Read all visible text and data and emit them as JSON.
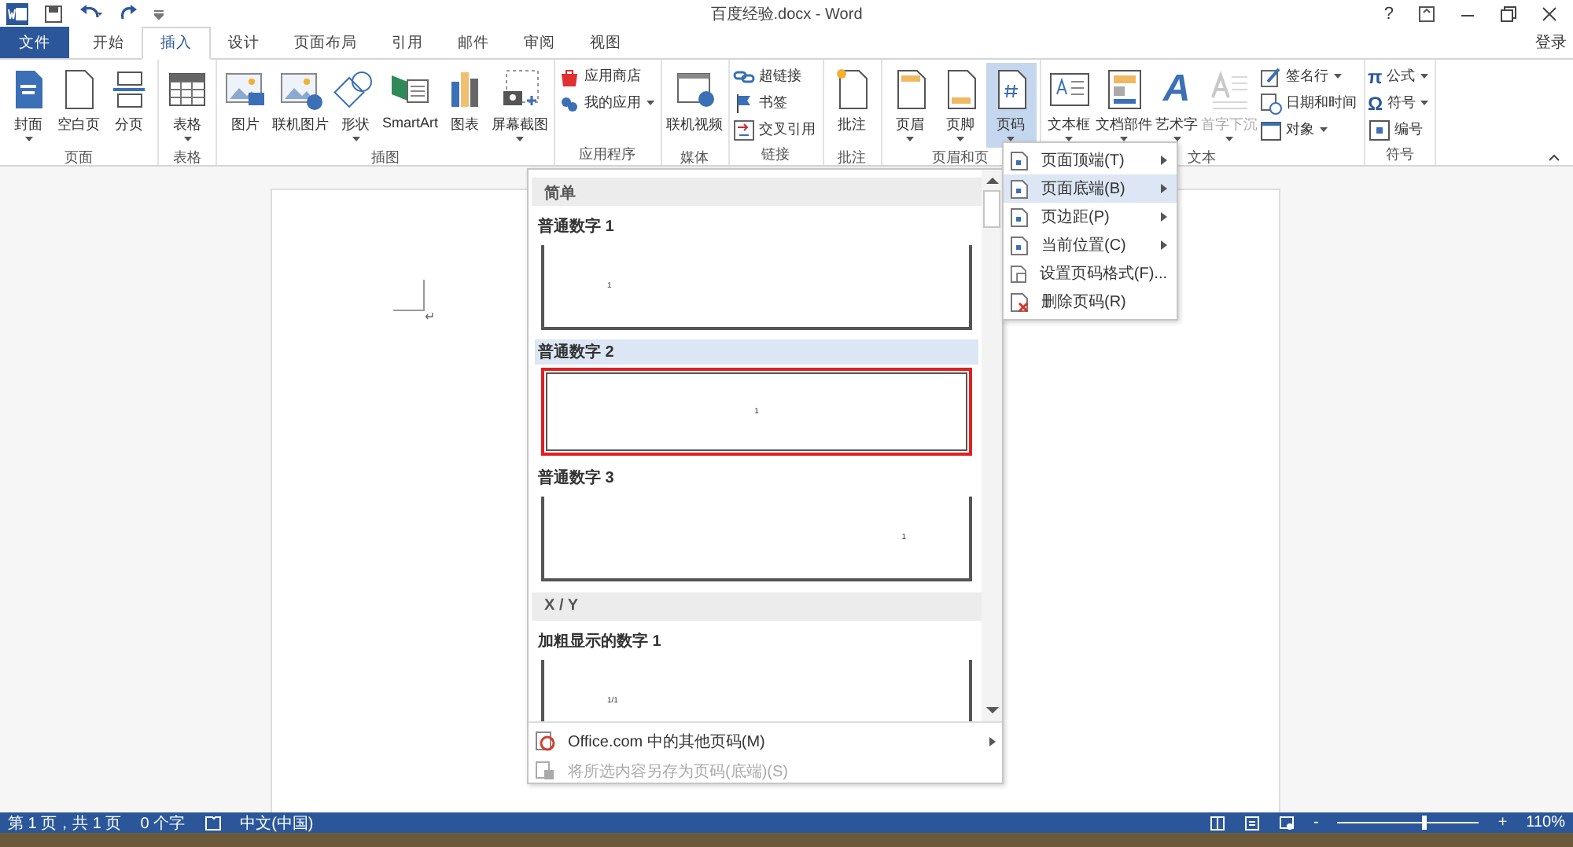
{
  "window": {
    "title": "百度经验.docx - Word",
    "help": "?",
    "login": "登录"
  },
  "tabs": [
    {
      "label": "文件",
      "kind": "file",
      "selected": false
    },
    {
      "label": "开始",
      "kind": "normal",
      "selected": false
    },
    {
      "label": "插入",
      "kind": "normal",
      "selected": true
    },
    {
      "label": "设计",
      "kind": "normal",
      "selected": false
    },
    {
      "label": "页面布局",
      "kind": "normal",
      "selected": false
    },
    {
      "label": "引用",
      "kind": "normal",
      "selected": false
    },
    {
      "label": "邮件",
      "kind": "normal",
      "selected": false
    },
    {
      "label": "审阅",
      "kind": "normal",
      "selected": false
    },
    {
      "label": "视图",
      "kind": "normal",
      "selected": false
    }
  ],
  "ribbon": {
    "groups": [
      {
        "label": "页面",
        "items": [
          {
            "label": "封面",
            "kind": "large",
            "dropdown": true,
            "pressed": false,
            "disabled": false
          },
          {
            "label": "空白页",
            "kind": "large",
            "dropdown": false,
            "pressed": false,
            "disabled": false
          },
          {
            "label": "分页",
            "kind": "large",
            "dropdown": false,
            "pressed": false,
            "disabled": false
          }
        ]
      },
      {
        "label": "表格",
        "items": [
          {
            "label": "表格",
            "kind": "large",
            "dropdown": true,
            "pressed": false,
            "disabled": false
          }
        ]
      },
      {
        "label": "插图",
        "items": [
          {
            "label": "图片",
            "kind": "large",
            "dropdown": false,
            "pressed": false,
            "disabled": false
          },
          {
            "label": "联机图片",
            "kind": "large",
            "dropdown": false,
            "pressed": false,
            "disabled": false
          },
          {
            "label": "形状",
            "kind": "large",
            "dropdown": true,
            "pressed": false,
            "disabled": false
          },
          {
            "label": "SmartArt",
            "kind": "large",
            "dropdown": false,
            "pressed": false,
            "disabled": false
          },
          {
            "label": "图表",
            "kind": "large",
            "dropdown": false,
            "pressed": false,
            "disabled": false
          },
          {
            "label": "屏幕截图",
            "kind": "large",
            "dropdown": true,
            "pressed": false,
            "disabled": false
          }
        ]
      },
      {
        "label": "应用程序",
        "items": [
          {
            "label": "应用商店",
            "kind": "small",
            "dropdown": false,
            "pressed": false,
            "disabled": false
          },
          {
            "label": "我的应用",
            "kind": "small",
            "dropdown": true,
            "pressed": false,
            "disabled": false
          }
        ]
      },
      {
        "label": "媒体",
        "items": [
          {
            "label": "联机视频",
            "kind": "large",
            "dropdown": false,
            "pressed": false,
            "disabled": false
          }
        ]
      },
      {
        "label": "链接",
        "items": [
          {
            "label": "超链接",
            "kind": "small",
            "dropdown": false,
            "pressed": false,
            "disabled": false
          },
          {
            "label": "书签",
            "kind": "small",
            "dropdown": false,
            "pressed": false,
            "disabled": false
          },
          {
            "label": "交叉引用",
            "kind": "small",
            "dropdown": false,
            "pressed": false,
            "disabled": false
          }
        ]
      },
      {
        "label": "批注",
        "items": [
          {
            "label": "批注",
            "kind": "large",
            "dropdown": false,
            "pressed": false,
            "disabled": false
          }
        ]
      },
      {
        "label": "页眉和页",
        "items": [
          {
            "label": "页眉",
            "kind": "large",
            "dropdown": true,
            "pressed": false,
            "disabled": false
          },
          {
            "label": "页脚",
            "kind": "large",
            "dropdown": true,
            "pressed": false,
            "disabled": false
          },
          {
            "label": "页码",
            "kind": "large",
            "dropdown": true,
            "pressed": true,
            "disabled": false
          }
        ]
      },
      {
        "label": "文本",
        "items": [
          {
            "label": "文本框",
            "kind": "large",
            "dropdown": true,
            "pressed": false,
            "disabled": false
          },
          {
            "label": "文档部件",
            "kind": "large",
            "dropdown": true,
            "pressed": false,
            "disabled": false
          },
          {
            "label": "艺术字",
            "kind": "large",
            "dropdown": true,
            "pressed": false,
            "disabled": false,
            "icon_char": "A"
          },
          {
            "label": "首字下沉",
            "kind": "large",
            "dropdown": true,
            "pressed": false,
            "disabled": true
          },
          {
            "label": "签名行",
            "kind": "small",
            "dropdown": true,
            "pressed": false,
            "disabled": false
          },
          {
            "label": "日期和时间",
            "kind": "small",
            "dropdown": false,
            "pressed": false,
            "disabled": false
          },
          {
            "label": "对象",
            "kind": "small",
            "dropdown": true,
            "pressed": false,
            "disabled": false
          }
        ]
      },
      {
        "label": "符号",
        "items": [
          {
            "label": "公式",
            "kind": "small",
            "dropdown": true,
            "pressed": false,
            "disabled": false,
            "icon_char": "π"
          },
          {
            "label": "符号",
            "kind": "small",
            "dropdown": true,
            "pressed": false,
            "disabled": false,
            "icon_char": "Ω"
          },
          {
            "label": "编号",
            "kind": "small",
            "dropdown": false,
            "pressed": false,
            "disabled": false
          }
        ]
      }
    ]
  },
  "document": {
    "paragraph_mark": "↵"
  },
  "gallery": {
    "sections": [
      {
        "heading": "简单",
        "items": [
          {
            "label": "普通数字 1",
            "number": "1",
            "kind": "left",
            "selected": false
          },
          {
            "label": "普通数字 2",
            "number": "1",
            "kind": "center",
            "selected": true
          },
          {
            "label": "普通数字 3",
            "number": "1",
            "kind": "right",
            "selected": false
          }
        ]
      },
      {
        "heading": "X / Y",
        "items": [
          {
            "label": "加粗显示的数字 1",
            "number": "1/1",
            "kind": "left",
            "selected": false
          }
        ]
      }
    ],
    "footer": [
      {
        "label": "Office.com 中的其他页码(M)",
        "disabled": false,
        "submenu": true
      },
      {
        "label": "将所选内容另存为页码(底端)(S)",
        "disabled": true,
        "submenu": false
      }
    ]
  },
  "submenu": [
    {
      "label": "页面顶端(T)",
      "selected": false,
      "submenu": true
    },
    {
      "label": "页面底端(B)",
      "selected": true,
      "submenu": true
    },
    {
      "label": "页边距(P)",
      "selected": false,
      "submenu": true
    },
    {
      "label": "当前位置(C)",
      "selected": false,
      "submenu": true
    },
    {
      "label": "设置页码格式(F)...",
      "selected": false,
      "submenu": false
    },
    {
      "label": "删除页码(R)",
      "selected": false,
      "submenu": false
    }
  ],
  "status_bar": {
    "page": "第 1 页，共 1 页",
    "words": "0 个字",
    "language": "中文(中国)",
    "zoom_out": "-",
    "zoom_in": "+",
    "zoom": {
      "level": 0.6
    },
    "zoom_text": "110%"
  }
}
